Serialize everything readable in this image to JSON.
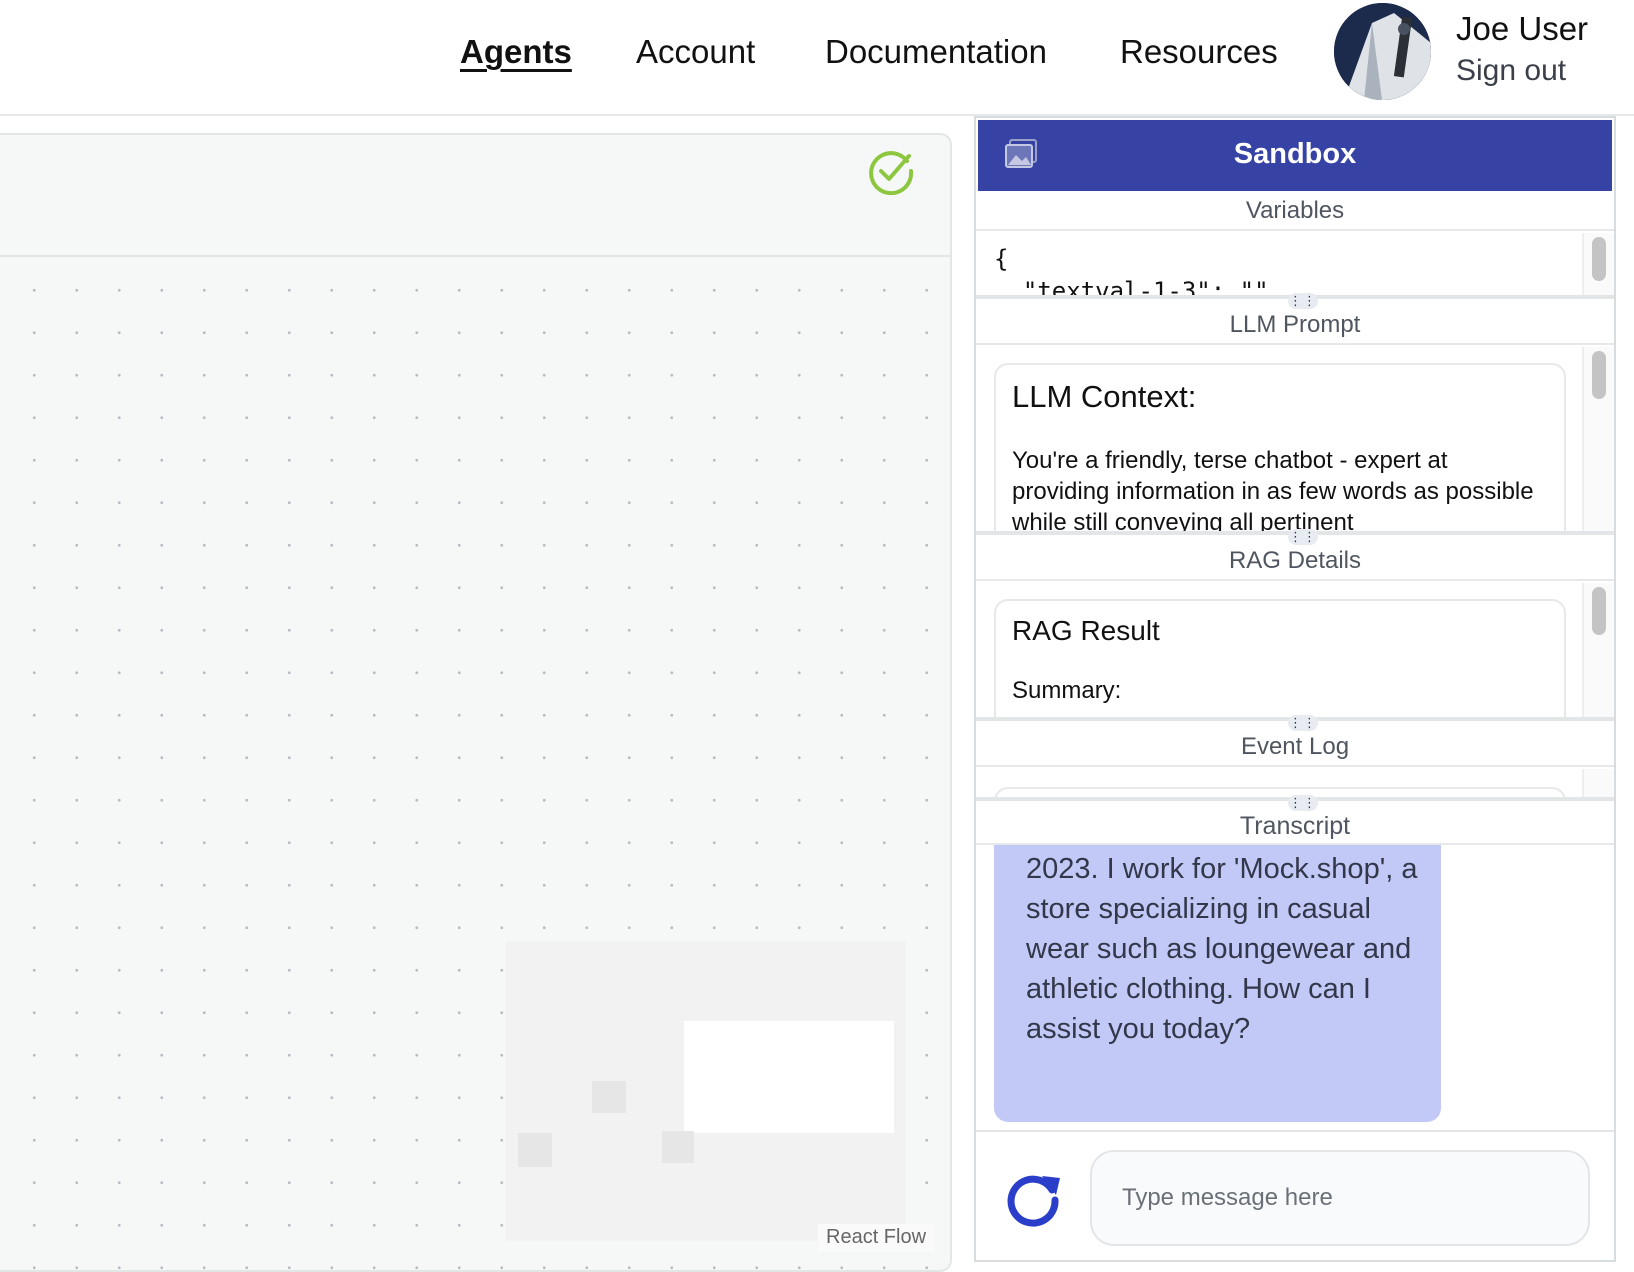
{
  "nav": {
    "links": [
      {
        "label": "Agents",
        "active": true
      },
      {
        "label": "Account",
        "active": false
      },
      {
        "label": "Documentation",
        "active": false
      },
      {
        "label": "Resources",
        "active": false
      }
    ],
    "user_name": "Joe User",
    "sign_out": "Sign out"
  },
  "canvas": {
    "status_icon": "check-circle-icon",
    "attribution": "React Flow"
  },
  "sandbox": {
    "title": "Sandbox",
    "icon": "image-icon",
    "accent_color": "#3643a5",
    "variables": {
      "title": "Variables",
      "lines": [
        "{",
        "  \"textval-1-3\": \"\""
      ]
    },
    "llm_prompt": {
      "title": "LLM Prompt",
      "heading": "LLM Context:",
      "body": "You're a friendly, terse chatbot - expert at providing information in as few words as possible while still conveying all pertinent"
    },
    "rag": {
      "title": "RAG Details",
      "heading": "RAG Result",
      "summary_label": "Summary:"
    },
    "event_log": {
      "title": "Event Log"
    },
    "transcript": {
      "title": "Transcript",
      "bubble_color": "#c2c9f7",
      "message": "2023. I work for 'Mock.shop', a store specializing in casual wear such as loungewear and athletic clothing. How can I assist you today?",
      "input_placeholder": "Type message here",
      "refresh_icon": "refresh-icon"
    }
  }
}
